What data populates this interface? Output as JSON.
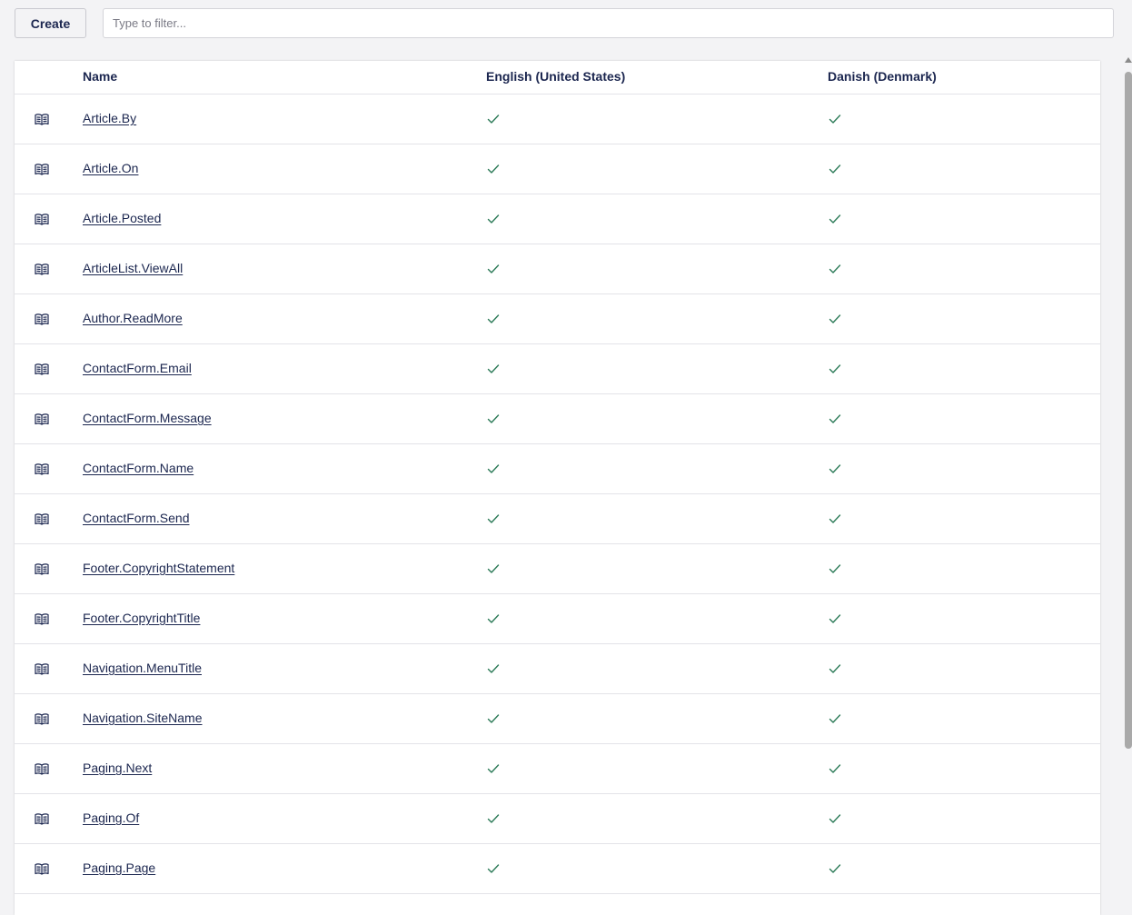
{
  "toolbar": {
    "create_label": "Create",
    "filter_placeholder": "Type to filter..."
  },
  "table": {
    "columns": [
      "Name",
      "English (United States)",
      "Danish (Denmark)"
    ],
    "rows": [
      {
        "name": "Article.By",
        "en": true,
        "da": true
      },
      {
        "name": "Article.On",
        "en": true,
        "da": true
      },
      {
        "name": "Article.Posted",
        "en": true,
        "da": true
      },
      {
        "name": "ArticleList.ViewAll",
        "en": true,
        "da": true
      },
      {
        "name": "Author.ReadMore",
        "en": true,
        "da": true
      },
      {
        "name": "ContactForm.Email",
        "en": true,
        "da": true
      },
      {
        "name": "ContactForm.Message",
        "en": true,
        "da": true
      },
      {
        "name": "ContactForm.Name",
        "en": true,
        "da": true
      },
      {
        "name": "ContactForm.Send",
        "en": true,
        "da": true
      },
      {
        "name": "Footer.CopyrightStatement",
        "en": true,
        "da": true
      },
      {
        "name": "Footer.CopyrightTitle",
        "en": true,
        "da": true
      },
      {
        "name": "Navigation.MenuTitle",
        "en": true,
        "da": true
      },
      {
        "name": "Navigation.SiteName",
        "en": true,
        "da": true
      },
      {
        "name": "Paging.Next",
        "en": true,
        "da": true
      },
      {
        "name": "Paging.Of",
        "en": true,
        "da": true
      },
      {
        "name": "Paging.Page",
        "en": true,
        "da": true
      },
      {
        "name": "",
        "en": false,
        "da": false
      }
    ]
  },
  "icons": {
    "row_icon": "book-open-icon",
    "translated_icon": "check-icon"
  },
  "colors": {
    "text": "#1b264f",
    "check": "#2b7a57",
    "background": "#f3f3f5"
  }
}
